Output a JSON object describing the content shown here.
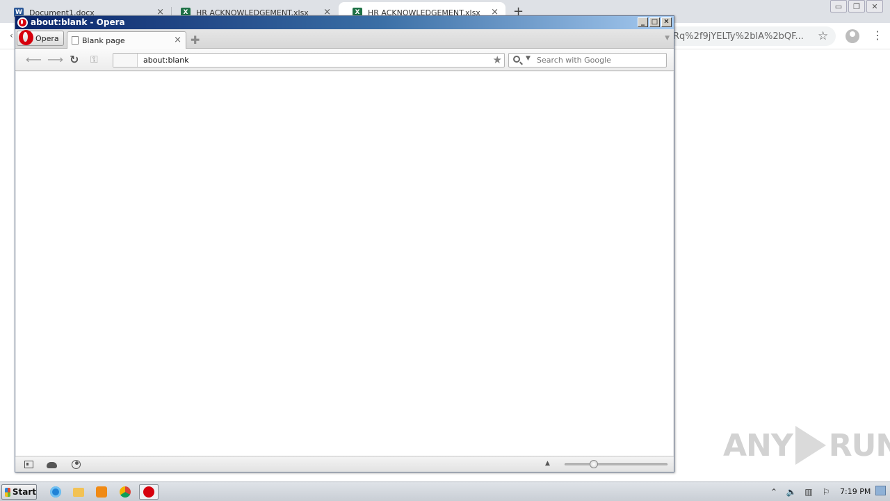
{
  "chrome": {
    "tabs": [
      {
        "label": "Document1.docx",
        "icon_color": "#2b5797",
        "icon_letter": "W"
      },
      {
        "label": "HR ACKNOWLEDGEMENT.xlsx",
        "icon_color": "#1e7145",
        "icon_letter": "X"
      },
      {
        "label": "HR ACKNOWLEDGEMENT.xlsx",
        "icon_color": "#1e7145",
        "icon_letter": "X"
      }
    ],
    "close_glyph": "×",
    "new_tab_glyph": "+",
    "omnibox_text": "Rq%2f9jYELTy%2blA%2bQF...",
    "star_icon": "☆",
    "menu_icon": "⋮",
    "back_fragment": "‹"
  },
  "opera": {
    "title": "about:blank - Opera",
    "menu_label": "Opera",
    "tab_label": "Blank page",
    "tab_close": "×",
    "new_tab": "✚",
    "address": "about:blank",
    "search_placeholder": "Search with Google",
    "title_buttons": {
      "minimize": "_",
      "maximize": "□",
      "close": "✕"
    }
  },
  "taskbar": {
    "start_label": "Start",
    "clock": "7:19 PM"
  },
  "watermark": {
    "left": "ANY",
    "right": "RUN"
  }
}
